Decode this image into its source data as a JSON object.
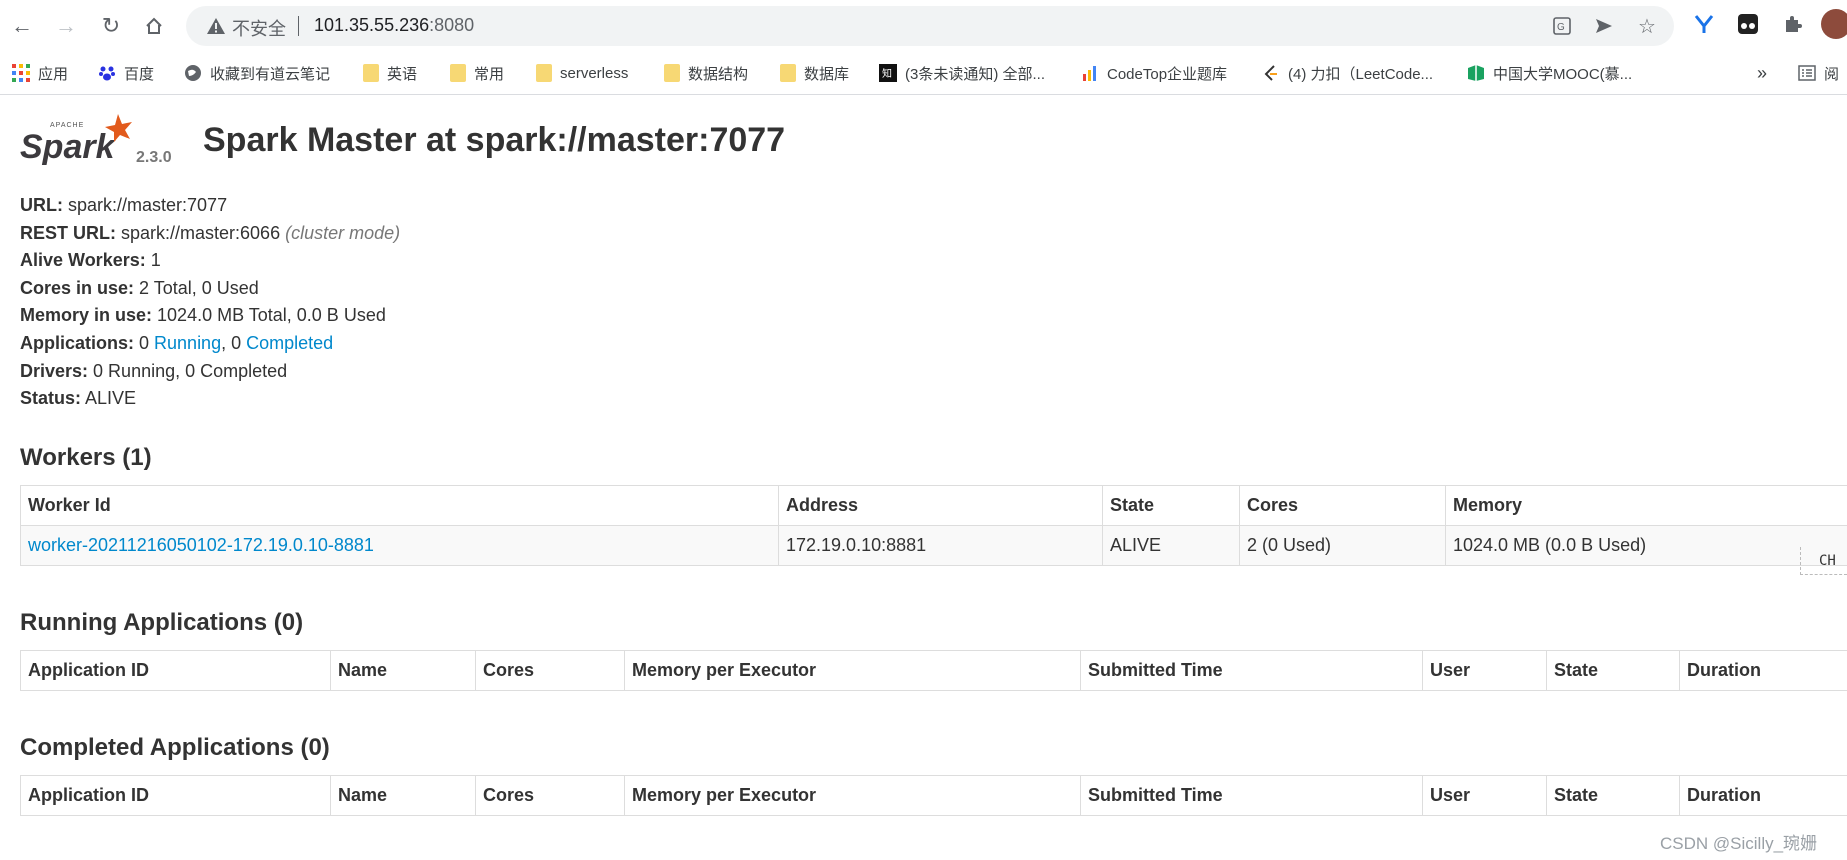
{
  "browser": {
    "insecure_label": "不安全",
    "url_host": "101.35.55.236",
    "url_port": ":8080",
    "bookmarks": [
      {
        "label": "应用",
        "icon": "apps-grid-icon"
      },
      {
        "label": "百度",
        "icon": "baidu-paw-icon"
      },
      {
        "label": "收藏到有道云笔记",
        "icon": "globe-icon"
      },
      {
        "label": "英语",
        "icon": "folder-icon"
      },
      {
        "label": "常用",
        "icon": "folder-icon"
      },
      {
        "label": "serverless",
        "icon": "folder-icon"
      },
      {
        "label": "数据结构",
        "icon": "folder-icon"
      },
      {
        "label": "数据库",
        "icon": "folder-icon"
      },
      {
        "label": "(3条未读通知) 全部...",
        "icon": "zhihu-icon"
      },
      {
        "label": "CodeTop企业题库",
        "icon": "bar-chart-icon"
      },
      {
        "label": "(4) 力扣（LeetCode...",
        "icon": "leetcode-icon"
      },
      {
        "label": "中国大学MOOC(慕...",
        "icon": "mooc-icon"
      }
    ],
    "more": "»",
    "reading_list": "阅"
  },
  "spark": {
    "version": "2.3.0",
    "title": "Spark Master at spark://master:7077",
    "info": {
      "url_label": "URL:",
      "url_value": " spark://master:7077",
      "rest_label": "REST URL:",
      "rest_value": " spark://master:6066 ",
      "rest_mode": "(cluster mode)",
      "alive_label": "Alive Workers:",
      "alive_value": " 1",
      "cores_label": "Cores in use:",
      "cores_value": " 2 Total, 0 Used",
      "memory_label": "Memory in use:",
      "memory_value": " 1024.0 MB Total, 0.0 B Used",
      "apps_label": "Applications:",
      "apps_running_count": " 0 ",
      "apps_running_link": "Running",
      "apps_completed_count": ", 0 ",
      "apps_completed_link": "Completed",
      "drivers_label": "Drivers:",
      "drivers_value": " 0 Running, 0 Completed",
      "status_label": "Status:",
      "status_value": " ALIVE"
    },
    "workers": {
      "heading": "Workers (1)",
      "headers": [
        "Worker Id",
        "Address",
        "State",
        "Cores",
        "Memory"
      ],
      "rows": [
        [
          "worker-20211216050102-172.19.0.10-8881",
          "172.19.0.10:8881",
          "ALIVE",
          "2 (0 Used)",
          "1024.0 MB (0.0 B Used)"
        ]
      ]
    },
    "running": {
      "heading": "Running Applications (0)",
      "headers": [
        "Application ID",
        "Name",
        "Cores",
        "Memory per Executor",
        "Submitted Time",
        "User",
        "State",
        "Duration"
      ]
    },
    "completed": {
      "heading": "Completed Applications (0)",
      "headers": [
        "Application ID",
        "Name",
        "Cores",
        "Memory per Executor",
        "Submitted Time",
        "User",
        "State",
        "Duration"
      ]
    }
  },
  "overlay": {
    "ime": "CH",
    "watermark": "CSDN @Sicilly_琬姗"
  }
}
